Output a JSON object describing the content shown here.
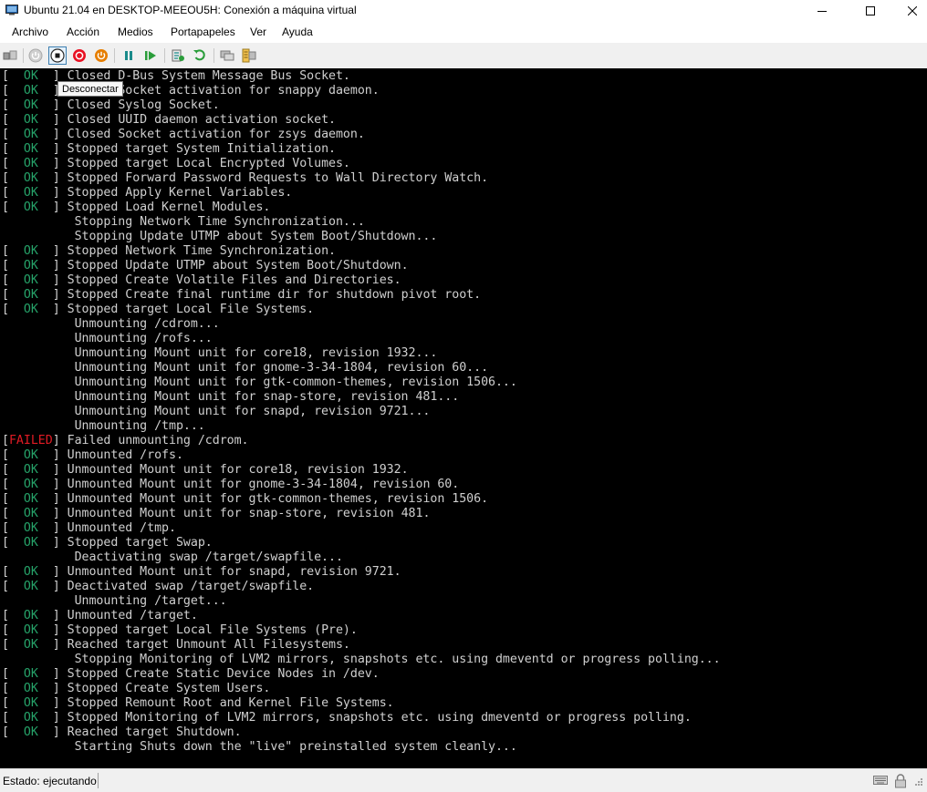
{
  "window": {
    "title": "Ubuntu 21.04 en DESKTOP-MEEOU5H: Conexión a máquina virtual",
    "icons": [
      "vm-connection-icon",
      "minimize-icon",
      "maximize-icon",
      "close-icon"
    ]
  },
  "menu": {
    "items": [
      "Archivo",
      "Acción",
      "Medios",
      "Portapapeles",
      "Ver",
      "Ayuda"
    ]
  },
  "toolbar": {
    "tooltip": "Desconectar",
    "icons": [
      "ctrl-alt-del-icon",
      "start-icon",
      "turn-off-icon",
      "shutdown-icon",
      "power-icon",
      "pause-icon",
      "resume-icon",
      "checkpoint-icon",
      "revert-icon",
      "enhanced-session-icon",
      "zoom-icon"
    ],
    "colors": {
      "red": "#e81123",
      "orange": "#e67e00",
      "teal": "#1a8a8a",
      "green": "#2a9d3a"
    }
  },
  "console": {
    "lines": [
      {
        "status": "OK",
        "text": "Closed D-Bus System Message Bus Socket."
      },
      {
        "status": "OK",
        "text": "Closed Socket activation for snappy daemon."
      },
      {
        "status": "OK",
        "text": "Closed Syslog Socket."
      },
      {
        "status": "OK",
        "text": "Closed UUID daemon activation socket."
      },
      {
        "status": "OK",
        "text": "Closed Socket activation for zsys daemon."
      },
      {
        "status": "OK",
        "text": "Stopped target System Initialization."
      },
      {
        "status": "OK",
        "text": "Stopped target Local Encrypted Volumes."
      },
      {
        "status": "OK",
        "text": "Stopped Forward Password Requests to Wall Directory Watch."
      },
      {
        "status": "OK",
        "text": "Stopped Apply Kernel Variables."
      },
      {
        "status": "OK",
        "text": "Stopped Load Kernel Modules."
      },
      {
        "status": "",
        "text": "Stopping Network Time Synchronization..."
      },
      {
        "status": "",
        "text": "Stopping Update UTMP about System Boot/Shutdown..."
      },
      {
        "status": "OK",
        "text": "Stopped Network Time Synchronization."
      },
      {
        "status": "OK",
        "text": "Stopped Update UTMP about System Boot/Shutdown."
      },
      {
        "status": "OK",
        "text": "Stopped Create Volatile Files and Directories."
      },
      {
        "status": "OK",
        "text": "Stopped Create final runtime dir for shutdown pivot root."
      },
      {
        "status": "OK",
        "text": "Stopped target Local File Systems."
      },
      {
        "status": "",
        "text": "Unmounting /cdrom..."
      },
      {
        "status": "",
        "text": "Unmounting /rofs..."
      },
      {
        "status": "",
        "text": "Unmounting Mount unit for core18, revision 1932..."
      },
      {
        "status": "",
        "text": "Unmounting Mount unit for gnome-3-34-1804, revision 60..."
      },
      {
        "status": "",
        "text": "Unmounting Mount unit for gtk-common-themes, revision 1506..."
      },
      {
        "status": "",
        "text": "Unmounting Mount unit for snap-store, revision 481..."
      },
      {
        "status": "",
        "text": "Unmounting Mount unit for snapd, revision 9721..."
      },
      {
        "status": "",
        "text": "Unmounting /tmp..."
      },
      {
        "status": "FAILED",
        "text": "Failed unmounting /cdrom."
      },
      {
        "status": "OK",
        "text": "Unmounted /rofs."
      },
      {
        "status": "OK",
        "text": "Unmounted Mount unit for core18, revision 1932."
      },
      {
        "status": "OK",
        "text": "Unmounted Mount unit for gnome-3-34-1804, revision 60."
      },
      {
        "status": "OK",
        "text": "Unmounted Mount unit for gtk-common-themes, revision 1506."
      },
      {
        "status": "OK",
        "text": "Unmounted Mount unit for snap-store, revision 481."
      },
      {
        "status": "OK",
        "text": "Unmounted /tmp."
      },
      {
        "status": "OK",
        "text": "Stopped target Swap."
      },
      {
        "status": "",
        "text": "Deactivating swap /target/swapfile..."
      },
      {
        "status": "OK",
        "text": "Unmounted Mount unit for snapd, revision 9721."
      },
      {
        "status": "OK",
        "text": "Deactivated swap /target/swapfile."
      },
      {
        "status": "",
        "text": "Unmounting /target..."
      },
      {
        "status": "OK",
        "text": "Unmounted /target."
      },
      {
        "status": "OK",
        "text": "Stopped target Local File Systems (Pre)."
      },
      {
        "status": "OK",
        "text": "Reached target Unmount All Filesystems."
      },
      {
        "status": "",
        "text": "Stopping Monitoring of LVM2 mirrors, snapshots etc. using dmeventd or progress polling..."
      },
      {
        "status": "OK",
        "text": "Stopped Create Static Device Nodes in /dev."
      },
      {
        "status": "OK",
        "text": "Stopped Create System Users."
      },
      {
        "status": "OK",
        "text": "Stopped Remount Root and Kernel File Systems."
      },
      {
        "status": "OK",
        "text": "Stopped Monitoring of LVM2 mirrors, snapshots etc. using dmeventd or progress polling."
      },
      {
        "status": "OK",
        "text": "Reached target Shutdown."
      },
      {
        "status": "",
        "text": "Starting Shuts down the \"live\" preinstalled system cleanly..."
      }
    ],
    "colors": {
      "background": "#000000",
      "text": "#cfcfcf",
      "ok": "#26a269",
      "failed": "#e01b24"
    }
  },
  "status": {
    "text": "Estado: ejecutando",
    "icons": [
      "keyboard-icon",
      "lock-icon"
    ]
  }
}
